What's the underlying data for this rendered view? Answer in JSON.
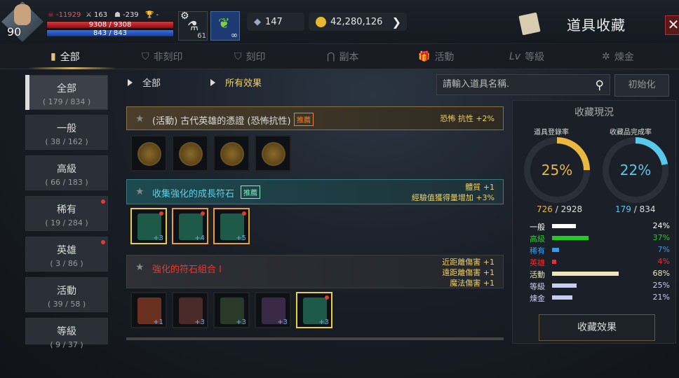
{
  "player": {
    "level": "90",
    "stat1": "-11929",
    "stat2": "163",
    "stat3": "-239",
    "stat4": "-",
    "hp": "9308 / 9308",
    "mp": "843 / 843",
    "item_count": "61"
  },
  "currency": {
    "crystal": "147",
    "gold": "42,280,126"
  },
  "window": {
    "title": "道具收藏",
    "close": "✕"
  },
  "tabs": [
    {
      "label": "全部"
    },
    {
      "label": "非刻印"
    },
    {
      "label": "刻印"
    },
    {
      "label": "副本"
    },
    {
      "label": "活動"
    },
    {
      "label": "等級"
    },
    {
      "label": "煉金"
    }
  ],
  "sidebar": [
    {
      "name": "全部",
      "count": "( 179 / 834 )"
    },
    {
      "name": "一般",
      "count": "( 38 / 162 )"
    },
    {
      "name": "高級",
      "count": "( 66 / 183 )"
    },
    {
      "name": "稀有",
      "count": "( 19 / 284 )"
    },
    {
      "name": "英雄",
      "count": "( 3 / 86 )"
    },
    {
      "name": "活動",
      "count": "( 39 / 58 )"
    },
    {
      "name": "等級",
      "count": "( 9 / 37 )"
    }
  ],
  "filters": {
    "category": "全部",
    "effect": "所有效果"
  },
  "search": {
    "placeholder": "請輸入道具名稱.",
    "reset": "初始化"
  },
  "collections": [
    {
      "title": "(活動) 古代英雄的憑證 (恐怖抗性)",
      "badge": "推薦",
      "effects": [
        "恐怖 抗性 +2%"
      ]
    },
    {
      "title": "收集強化的成長符石",
      "badge": "推薦",
      "effects": [
        "體質 +1",
        "經驗值獲得量增加 +3%"
      ],
      "levels": [
        "+3",
        "+4",
        "+5"
      ]
    },
    {
      "title": "強化的符石組合 I",
      "effects": [
        "近距離傷害 +1",
        "遠距離傷害 +1",
        "魔法傷害 +1"
      ],
      "levels": [
        "+1",
        "+3",
        "+3",
        "+3",
        "+3"
      ]
    }
  ],
  "status": {
    "title": "收藏現況",
    "reg_label": "道具登錄率",
    "reg_pct": "25%",
    "reg_value": 25,
    "reg_count": "726",
    "reg_total": "/ 2928",
    "done_label": "收藏品完成率",
    "done_pct": "22%",
    "done_value": 22,
    "done_count": "179",
    "done_total": "/ 834",
    "rows": [
      {
        "label": "一般",
        "pct": "24%",
        "value": 24,
        "color": "#ffffff"
      },
      {
        "label": "高級",
        "pct": "37%",
        "value": 37,
        "color": "#22cc22"
      },
      {
        "label": "稀有",
        "pct": "7%",
        "value": 7,
        "color": "#3a9ae8"
      },
      {
        "label": "英雄",
        "pct": "4%",
        "value": 4,
        "color": "#e83030"
      },
      {
        "label": "活動",
        "pct": "68%",
        "value": 68,
        "color": "#ece7b8"
      },
      {
        "label": "等級",
        "pct": "25%",
        "value": 25,
        "color": "#c8cdf2"
      },
      {
        "label": "煉金",
        "pct": "21%",
        "value": 21,
        "color": "#c8cdf2"
      }
    ],
    "button": "收藏效果"
  }
}
